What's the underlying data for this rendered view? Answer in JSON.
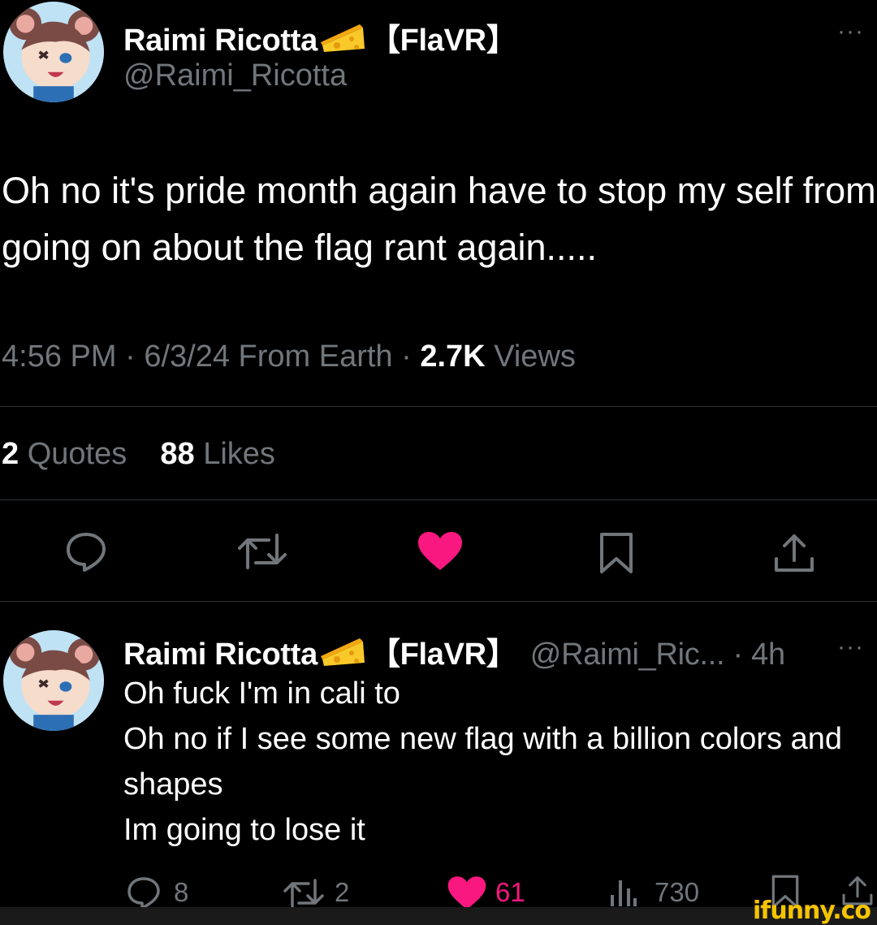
{
  "main_tweet": {
    "display_name": "Raimi Ricotta",
    "badge": "【FlaVR】",
    "emoji": "cheese-emoji",
    "handle": "@Raimi_Ricotta",
    "text": "Oh no it's pride month again have to stop my self from going on about the flag rant again.....",
    "time": "4:56 PM",
    "date": "6/3/24",
    "source": "From Earth",
    "views_count": "2.7K",
    "views_label": "Views",
    "quotes_count": "2",
    "quotes_label": "Quotes",
    "likes_count": "88",
    "likes_label": "Likes",
    "more_label": "···",
    "actions": [
      "reply-icon",
      "retweet-icon",
      "like-icon",
      "bookmark-icon",
      "share-icon"
    ],
    "liked_color": "#f91880"
  },
  "reply_tweet": {
    "display_name": "Raimi Ricotta",
    "badge": "【FlaVR】",
    "handle": "@Raimi_Ric...",
    "age": "· 4h",
    "more_label": "···",
    "text": "Oh fuck I'm in cali to\nOh no if I see some new flag with a billion colors and shapes\nIm going to lose it",
    "reply_count": "8",
    "retweet_count": "2",
    "like_count": "61",
    "views_count": "730"
  },
  "watermark": "ifunny.co"
}
